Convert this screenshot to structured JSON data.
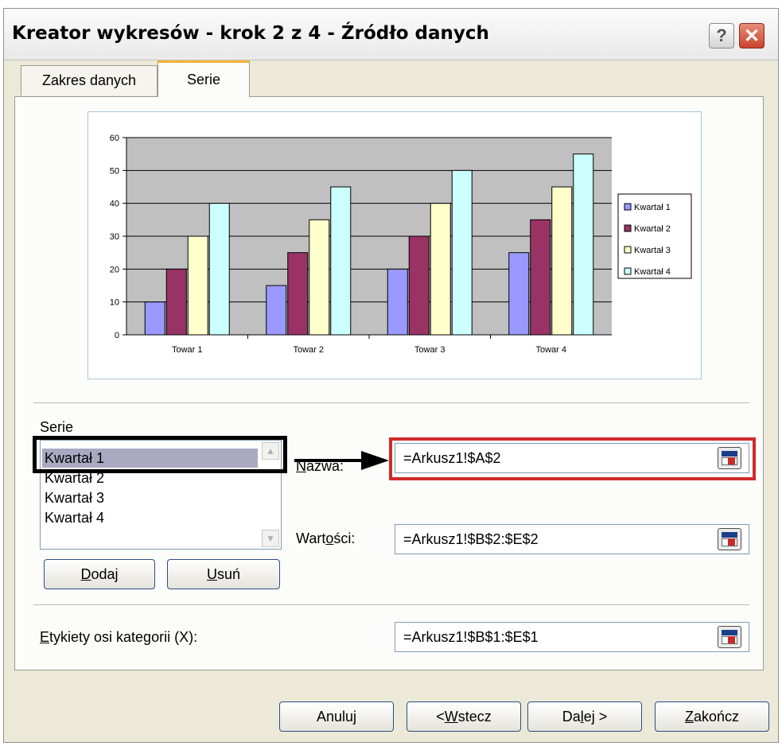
{
  "window": {
    "title": "Kreator wykresów - krok 2 z 4 - Źródło danych",
    "help_label": "?",
    "close_label": "✕"
  },
  "tabs": [
    {
      "label": "Zakres danych",
      "active": false
    },
    {
      "label": "Serie",
      "active": true
    }
  ],
  "chart_data": {
    "type": "bar",
    "categories": [
      "Towar 1",
      "Towar 2",
      "Towar 3",
      "Towar 4"
    ],
    "series": [
      {
        "name": "Kwartał 1",
        "values": [
          10,
          15,
          20,
          25
        ],
        "color": "#9999ff"
      },
      {
        "name": "Kwartał 2",
        "values": [
          20,
          25,
          30,
          35
        ],
        "color": "#993366"
      },
      {
        "name": "Kwartał 3",
        "values": [
          30,
          35,
          40,
          45
        ],
        "color": "#ffffcc"
      },
      {
        "name": "Kwartał 4",
        "values": [
          40,
          45,
          50,
          55
        ],
        "color": "#ccffff"
      }
    ],
    "ylim": [
      0,
      60
    ],
    "yticks": [
      "0",
      "10",
      "20",
      "30",
      "40",
      "50",
      "60"
    ],
    "grid": true,
    "plot_background": "#c0c0c0",
    "legend_position": "right"
  },
  "series_section": {
    "label": "Serie",
    "items": [
      "Kwartał 1",
      "Kwartał 2",
      "Kwartał 3",
      "Kwartał 4"
    ],
    "selected": "Kwartał 1",
    "add_button": {
      "underline": "D",
      "rest": "odaj"
    },
    "remove_button": {
      "underline": "U",
      "rest": "suń"
    }
  },
  "fields": {
    "name_label": {
      "underline": "N",
      "rest": "azwa:"
    },
    "name_value": "=Arkusz1!$A$2",
    "values_label": {
      "before": "Wart",
      "underline": "o",
      "after": "ści:"
    },
    "values_value": "=Arkusz1!$B$2:$E$2",
    "category_label": {
      "underline": "E",
      "rest": "tykiety osi kategorii (X):"
    },
    "category_value": "=Arkusz1!$B$1:$E$1"
  },
  "footer": {
    "cancel": "Anuluj",
    "back": {
      "before": "< ",
      "underline": "W",
      "after": "stecz"
    },
    "next": {
      "before": "Da",
      "underline": "l",
      "after": "ej >"
    },
    "finish": {
      "underline": "Z",
      "after": "akończ"
    }
  },
  "colors": {
    "highlight_red": "#d12a2a",
    "selection": "#aaa9c2",
    "active_tab_accent": "#f2b334"
  }
}
